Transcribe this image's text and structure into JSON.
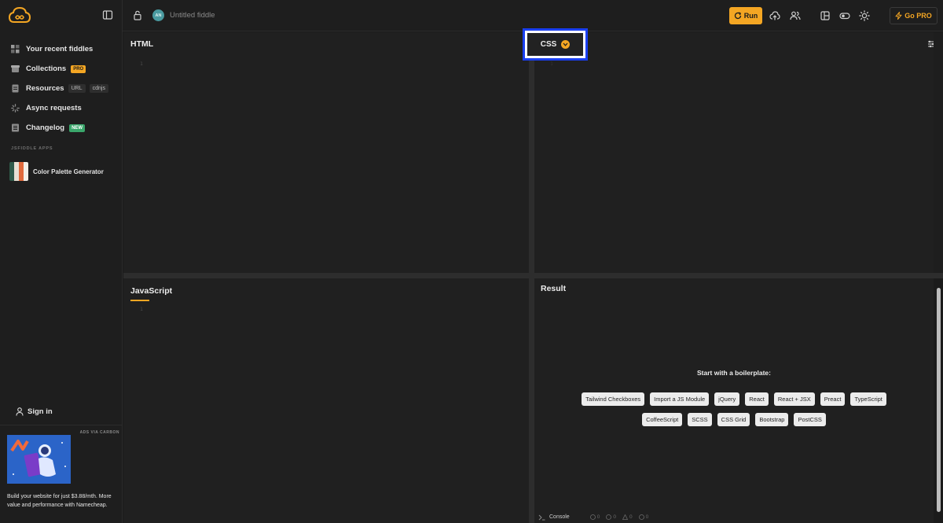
{
  "topbar": {
    "avatar_initials": "AN",
    "fiddle_title": "Untitled fiddle",
    "run_label": "Run",
    "gopro_label": "Go PRO"
  },
  "sidebar": {
    "items": [
      {
        "label": "Your recent fiddles",
        "icon": "grid-icon"
      },
      {
        "label": "Collections",
        "icon": "box-icon",
        "badge": "PRO"
      },
      {
        "label": "Resources",
        "icon": "file-icon",
        "badges": [
          "URL",
          "cdnjs"
        ]
      },
      {
        "label": "Async requests",
        "icon": "spinner-icon"
      },
      {
        "label": "Changelog",
        "icon": "list-icon",
        "badge": "NEW"
      }
    ],
    "apps_header": "JSFIDDLE APPS",
    "app_name": "Color Palette Generator",
    "signin_label": "Sign in",
    "ad_label": "ADS VIA CARBON",
    "ad_text": "Build your website for just $3.88/mth. More value and performance with Namecheap."
  },
  "panes": {
    "html_title": "HTML",
    "css_title": "CSS",
    "js_title": "JavaScript",
    "result_title": "Result",
    "line_number": "1"
  },
  "result": {
    "boilerplate_title": "Start with a boilerplate:",
    "row1": [
      "Tailwind Checkboxes",
      "Import a JS Module",
      "jQuery",
      "React",
      "React + JSX",
      "Preact",
      "TypeScript"
    ],
    "row2": [
      "CoffeeScript",
      "SCSS",
      "CSS Grid",
      "Bootstrap",
      "PostCSS"
    ]
  },
  "console": {
    "label": "Console",
    "counts": [
      "0",
      "0",
      "0",
      "0"
    ]
  },
  "colors": {
    "accent": "#f4a623",
    "highlight_box": "#1a3ff0"
  }
}
